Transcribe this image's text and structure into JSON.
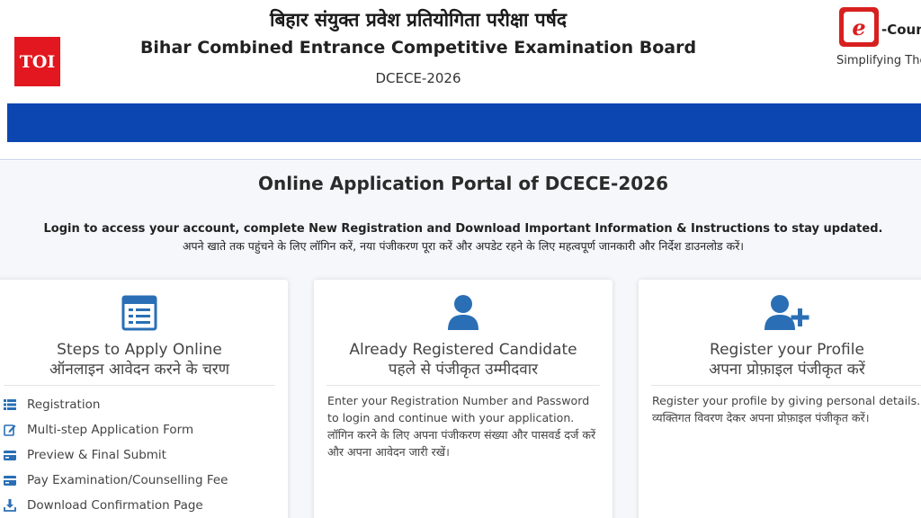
{
  "header": {
    "toi_logo": "TOI",
    "title_hindi": "बिहार संयुक्त प्रवेश प्रतियोगिता परीक्षा पर्षद",
    "title_english": "Bihar Combined Entrance Competitive Examination Board",
    "exam_code": "DCECE-2026",
    "brand_logo_letter": "e",
    "brand_name": "-Couns",
    "brand_tagline": "Simplifying The"
  },
  "colors": {
    "nav_bar": "#0c46b1",
    "toi_red": "#e2171f",
    "icon_blue": "#2a6fb5"
  },
  "main": {
    "portal_title": "Online Application Portal of DCECE-2026",
    "intro_english": "Login to access your account, complete New Registration and Download Important Information & Instructions to stay updated.",
    "intro_hindi": "अपने खाते तक पहुंचने के लिए लॉगिन करें, नया पंजीकरण पूरा करें और अपडेट रहने के लिए महत्वपूर्ण जानकारी और निर्देश डाउनलोड करें।"
  },
  "cards": [
    {
      "icon": "form-icon",
      "title": "Steps to Apply Online",
      "subtitle": "ऑनलाइन आवेदन करने के चरण",
      "steps": [
        {
          "icon": "list-icon",
          "label": "Registration"
        },
        {
          "icon": "edit-icon",
          "label": "Multi-step Application Form"
        },
        {
          "icon": "card-icon",
          "label": "Preview & Final Submit"
        },
        {
          "icon": "card-icon",
          "label": "Pay Examination/Counselling Fee"
        },
        {
          "icon": "download-icon",
          "label": "Download Confirmation Page"
        }
      ]
    },
    {
      "icon": "user-icon",
      "title": "Already Registered Candidate",
      "subtitle": "पहले से पंजीकृत उम्मीदवार",
      "text_en": "Enter your Registration Number and Password to login and continue with your application.",
      "text_hi": "लॉगिन करने के लिए अपना पंजीकरण संख्या और पासवर्ड दर्ज करें और अपना आवेदन जारी रखें।"
    },
    {
      "icon": "user-plus-icon",
      "title": "Register your Profile",
      "subtitle": "अपना प्रोफ़ाइल पंजीकृत करें",
      "text_en": "Register your profile by giving personal details.",
      "text_hi": "व्यक्तिगत विवरण देकर अपना प्रोफ़ाइल पंजीकृत करें।"
    }
  ]
}
